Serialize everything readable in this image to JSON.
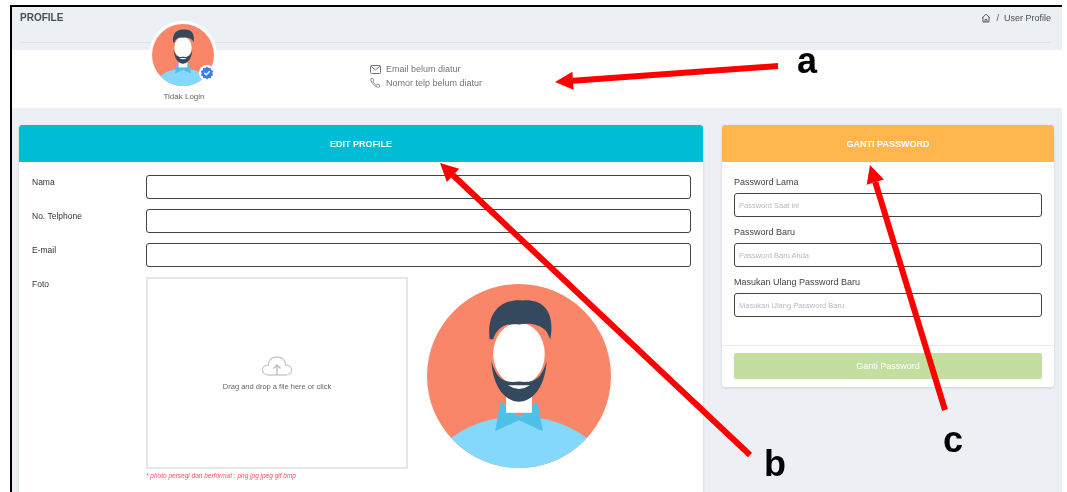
{
  "page_header": {
    "title": "PROFILE",
    "breadcrumb": {
      "separator": "/",
      "current": "User Profile"
    }
  },
  "profile_summary": {
    "status": "Tidak Login",
    "verified": true,
    "contacts": [
      {
        "kind": "email",
        "text": "Email belum diatur"
      },
      {
        "kind": "phone",
        "text": "Nomor telp belum diatur"
      }
    ]
  },
  "edit_profile": {
    "title": "EDIT PROFILE",
    "fields": [
      {
        "label": "Nama"
      },
      {
        "label": "No. Telphone"
      },
      {
        "label": "E-mail"
      }
    ],
    "photo": {
      "label": "Foto",
      "dropzone": "Drag and drop a file here or click",
      "hint": "* photo persegi dan berformat : png jpg jpeg gif bmp"
    }
  },
  "change_password": {
    "title": "GANTI PASSWORD",
    "fields": [
      {
        "label": "Password Lama",
        "placeholder": "Password Saat ini"
      },
      {
        "label": "Password Baru",
        "placeholder": "Password Baru Anda"
      },
      {
        "label": "Masukan Ulang Password Baru",
        "placeholder": "Masukan Ulang Password Baru"
      }
    ],
    "submit": {
      "label": "Ganti Password",
      "disabled": true
    }
  },
  "annotations": [
    {
      "label": "a"
    },
    {
      "label": "b"
    },
    {
      "label": "c"
    }
  ]
}
